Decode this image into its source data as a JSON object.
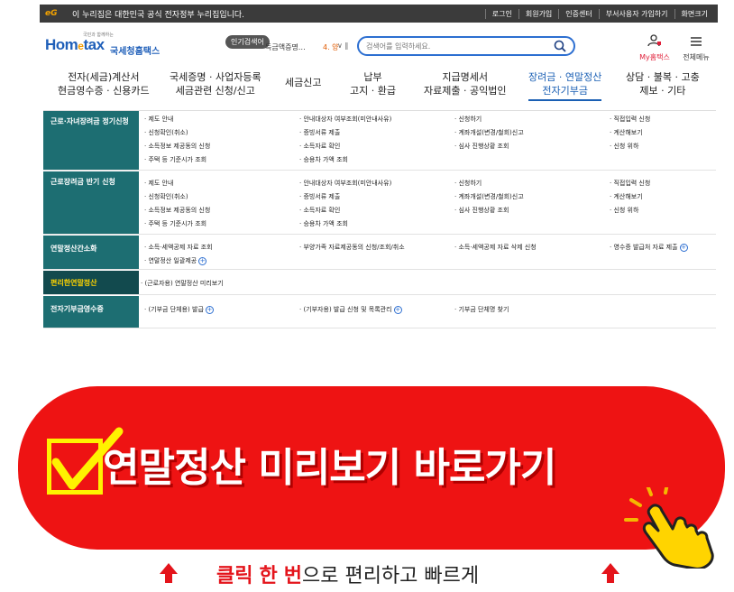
{
  "govbar": {
    "logo": "eG",
    "text": "이 누리집은 대한민국 공식 전자정부 누리집입니다.",
    "links": [
      "로그인",
      "회원가입",
      "인증센터",
      "부서사용자 가입하기",
      "화면크기"
    ]
  },
  "header": {
    "slogan": "국민과 함께하는",
    "brand_prefix": "Hom",
    "brand_e": "e",
    "brand_suffix": "tax",
    "agency": "국세청홈택스",
    "popular_label": "인기검색어",
    "popular_keyword": "득금액증명…",
    "popular_rank": "4. 양",
    "popular_ctrl": "∨ ‖",
    "search_placeholder": "검색어를 입력하세요.",
    "my_label": "My홈택스",
    "all_label": "전체메뉴"
  },
  "nav": [
    {
      "l1": "전자(세금)계산서",
      "l2": "현금영수증 · 신용카드"
    },
    {
      "l1": "국세증명 · 사업자등록",
      "l2": "세금관련 신청/신고"
    },
    {
      "l1": "세금신고",
      "l2": ""
    },
    {
      "l1": "납부",
      "l2": "고지 · 환급"
    },
    {
      "l1": "지급명세서",
      "l2": "자료제출 · 공익법인"
    },
    {
      "l1": "장려금 · 연말정산",
      "l2": "전자기부금"
    },
    {
      "l1": "상담 · 불복 · 고충",
      "l2": "제보 · 기타"
    }
  ],
  "panel": [
    {
      "cat": "근로·자녀장려금 정기신청",
      "links": [
        [
          "· 제도 안내",
          "· 안내대상자 여부조회(미안내사유)",
          "· 신청하기",
          "· 직접입력 신청"
        ],
        [
          "· 신청확인(취소)",
          "· 증빙서류 제출",
          "· 계좌개설(변경/철회)신고",
          "· 계산해보기"
        ],
        [
          "· 소득정보 제공동의 신청",
          "· 소득자료 확인",
          "· 심사 진행상황 조회",
          "· 신청 위하"
        ],
        [
          "· 주택 등 기준시가 조회",
          "· 승용차 가액 조회",
          "",
          ""
        ]
      ]
    },
    {
      "cat": "근로장려금 반기 신청",
      "links": [
        [
          "· 제도 안내",
          "· 안내대상자 여부조회(미안내사유)",
          "· 신청하기",
          "· 직접입력 신청"
        ],
        [
          "· 신청확인(취소)",
          "· 증빙서류 제출",
          "· 계좌개설(변경/철회)신고",
          "· 계산해보기"
        ],
        [
          "· 소득정보 제공동의 신청",
          "· 소득자료 확인",
          "· 심사 진행상황 조회",
          "· 신청 위하"
        ],
        [
          "· 주택 등 기준시가 조회",
          "· 승용차 가액 조회",
          "",
          ""
        ]
      ]
    },
    {
      "cat": "연말정산간소화",
      "links": [
        [
          "· 소득·세액공제 자료 조회",
          "· 부양가족 자료제공동의 신청/조회/취소",
          "· 소득·세액공제 자료 삭제 신청",
          "· 영수증 발급처 자료 제출"
        ],
        [
          "· 연말정산 일괄제공",
          "",
          "",
          ""
        ]
      ]
    },
    {
      "cat": "편리한연말정산",
      "links": [
        [
          "· (근로자용) 연말정산 미리보기",
          "",
          "",
          ""
        ]
      ]
    },
    {
      "cat": "전자기부금영수증",
      "links": [
        [
          "· (기부금 단체용) 발급",
          "· (기부자용) 발급 신청 및 목록관리",
          "· 기부금 단체명 찾기",
          ""
        ]
      ]
    }
  ],
  "banner": {
    "title": "연말정산 미리보기 바로가기"
  },
  "subline": {
    "w1": "클릭",
    "w2": "한",
    "w3": "번",
    "rest": "으로 편리하고 빠르게"
  },
  "colors": {
    "banner_red": "#ee1313",
    "category_teal": "#1d6e72",
    "check_yellow": "#fff200",
    "link_blue": "#1a5fb4"
  }
}
